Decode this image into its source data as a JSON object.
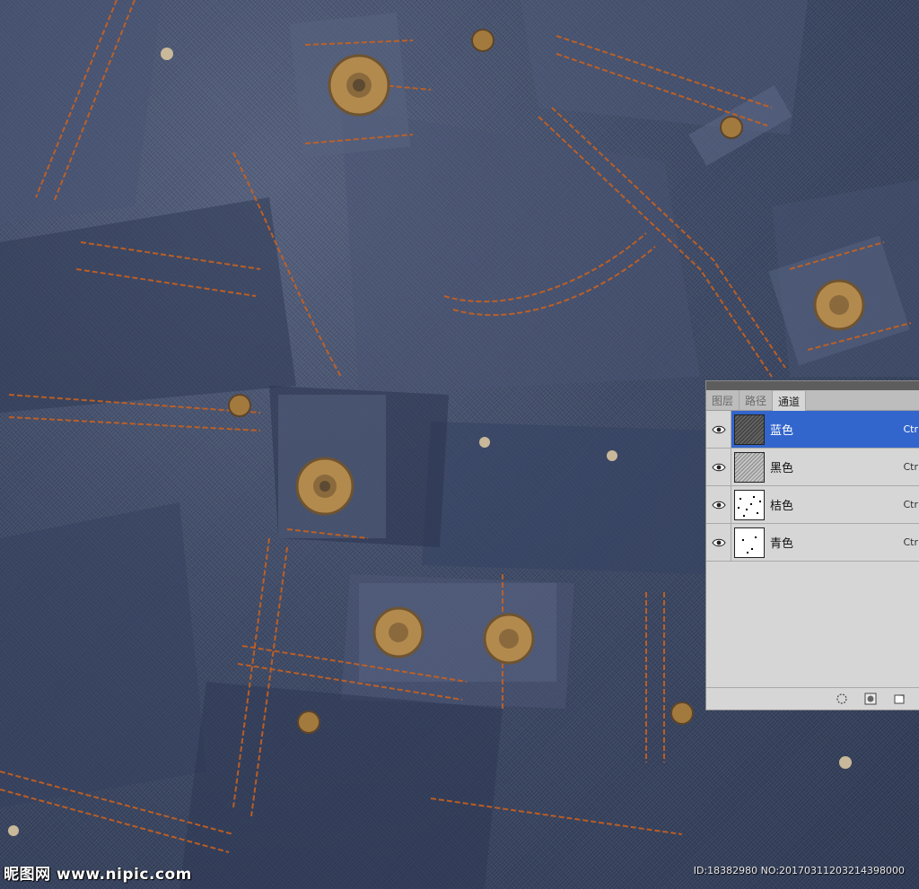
{
  "panel": {
    "tabs": [
      {
        "label": "图层",
        "active": false
      },
      {
        "label": "路径",
        "active": false
      },
      {
        "label": "通道",
        "active": true
      }
    ],
    "channels": [
      {
        "name": "蓝色",
        "shortcut": "Ctr",
        "selected": true,
        "thumb": "dark"
      },
      {
        "name": "黑色",
        "shortcut": "Ctr",
        "selected": false,
        "thumb": "grey"
      },
      {
        "name": "桔色",
        "shortcut": "Ctr",
        "selected": false,
        "thumb": "white"
      },
      {
        "name": "青色",
        "shortcut": "Ctr",
        "selected": false,
        "thumb": "white"
      }
    ],
    "icons": {
      "visibility": "eye-icon",
      "load_selection": "circle-dotted-icon",
      "save_selection": "mask-square-icon",
      "new_channel": "new-channel-icon"
    }
  },
  "watermark": {
    "left": "昵图网 www.nipic.com",
    "right": "ID:18382980 NO:20170311203214398000"
  },
  "colors": {
    "denim": "#3e4a66",
    "stitch": "#c8611f",
    "rivet": "#b38a4e",
    "selection": "#3366cc"
  }
}
